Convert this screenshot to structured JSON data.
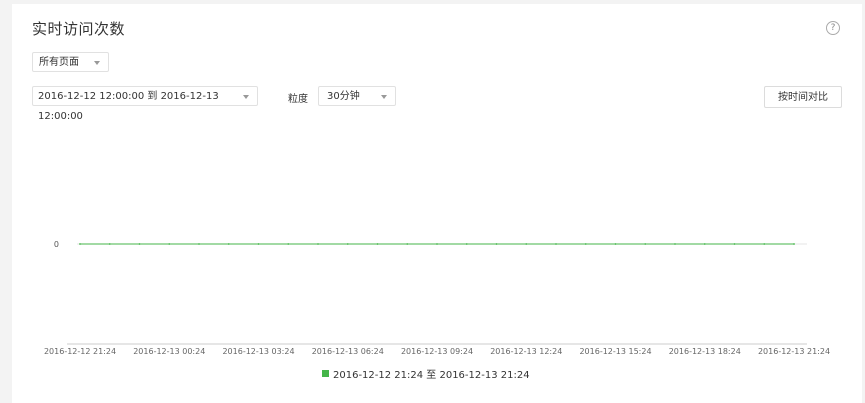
{
  "header": {
    "title": "实时访问次数",
    "help_icon": "?"
  },
  "filters": {
    "page_select": "所有页面",
    "range_select": "2016-12-12 12:00:00 到 2016-12-13 12:00:00",
    "granularity_label": "粒度",
    "interval_select": "30分钟",
    "compare_button": "按时间对比"
  },
  "colors": {
    "series": "#44b549",
    "grid": "#e5e5e5",
    "axis": "#cccccc"
  },
  "chart_data": {
    "type": "line",
    "title": "",
    "xlabel": "",
    "ylabel": "",
    "y_ticks": [
      "0"
    ],
    "x_ticks": [
      "2016-12-12 21:24",
      "2016-12-13 00:24",
      "2016-12-13 03:24",
      "2016-12-13 06:24",
      "2016-12-13 09:24",
      "2016-12-13 12:24",
      "2016-12-13 15:24",
      "2016-12-13 18:24",
      "2016-12-13 21:24"
    ],
    "ylim": [
      -1,
      1
    ],
    "grid": true,
    "legend": "bottom-center",
    "series": [
      {
        "name": "2016-12-12 21:24 至 2016-12-13 21:24",
        "values": [
          0,
          0,
          0,
          0,
          0,
          0,
          0,
          0,
          0,
          0,
          0,
          0,
          0,
          0,
          0,
          0,
          0,
          0,
          0,
          0,
          0,
          0,
          0,
          0,
          0
        ]
      }
    ]
  }
}
